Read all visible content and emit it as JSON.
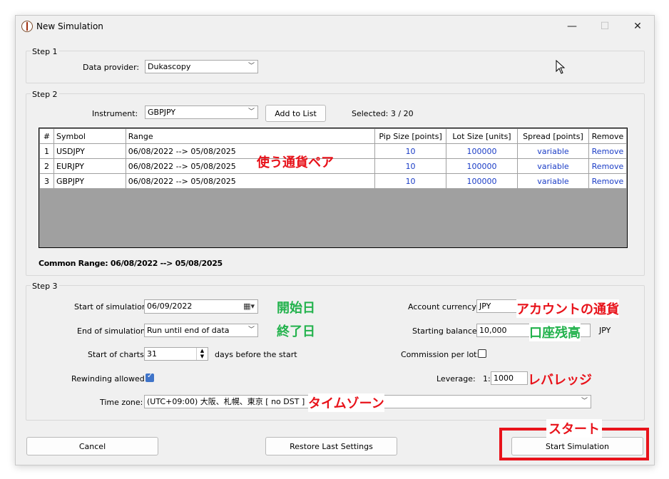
{
  "window": {
    "title": "New Simulation",
    "minimize": "—",
    "maximize": "☐",
    "close": "✕"
  },
  "step1": {
    "label": "Step 1",
    "provider_label": "Data provider:",
    "provider_value": "Dukascopy"
  },
  "step2": {
    "label": "Step 2",
    "instrument_label": "Instrument:",
    "instrument_value": "GBPJPY",
    "add_button": "Add to List",
    "selected": "Selected: 3 / 20",
    "columns": [
      "#",
      "Symbol",
      "Range",
      "Pip Size [points]",
      "Lot Size [units]",
      "Spread [points]",
      "Remove"
    ],
    "rows": [
      {
        "n": "1",
        "symbol": "USDJPY",
        "range": "06/08/2022 --> 05/08/2025",
        "pip": "10",
        "lot": "100000",
        "spread": "variable",
        "remove": "Remove"
      },
      {
        "n": "2",
        "symbol": "EURJPY",
        "range": "06/08/2022 --> 05/08/2025",
        "pip": "10",
        "lot": "100000",
        "spread": "variable",
        "remove": "Remove"
      },
      {
        "n": "3",
        "symbol": "GBPJPY",
        "range": "06/08/2022 --> 05/08/2025",
        "pip": "10",
        "lot": "100000",
        "spread": "variable",
        "remove": "Remove"
      }
    ],
    "common_range": "Common Range: 06/08/2022 --> 05/08/2025"
  },
  "step3": {
    "label": "Step 3",
    "start_label": "Start of simulation:",
    "start_value": "06/09/2022",
    "end_label": "End of simulation:",
    "end_value": "Run until end of data",
    "charts_label": "Start of charts:",
    "charts_value": "31",
    "charts_suffix": "days before the start",
    "rewind_label": "Rewinding allowed:",
    "rewind_checked": true,
    "timezone_label": "Time zone:",
    "timezone_value": "(UTC+09:00) 大阪、札幌、東京 [ no DST ]",
    "currency_label": "Account currency:",
    "currency_value": "JPY",
    "balance_label": "Starting balance:",
    "balance_value": "10,000",
    "balance_unit": "JPY",
    "commission_label": "Commission per lot:",
    "commission_checked": false,
    "leverage_label": "Leverage:",
    "leverage_prefix": "1:",
    "leverage_value": "1000"
  },
  "buttons": {
    "cancel": "Cancel",
    "restore": "Restore Last Settings",
    "start": "Start Simulation"
  },
  "annotations": {
    "currency_pair": "使う通貨ペア",
    "start_date": "開始日",
    "end_date": "終了日",
    "account_currency": "アカウントの通貨",
    "balance": "口座残高",
    "leverage": "レバレッジ",
    "timezone": "タイムゾーン",
    "start": "スタート"
  },
  "colors": {
    "annotation_red": "#e8121a",
    "annotation_green": "#22b24c",
    "link_blue": "#1a3cc6",
    "checkbox_blue": "#3f74c9"
  }
}
